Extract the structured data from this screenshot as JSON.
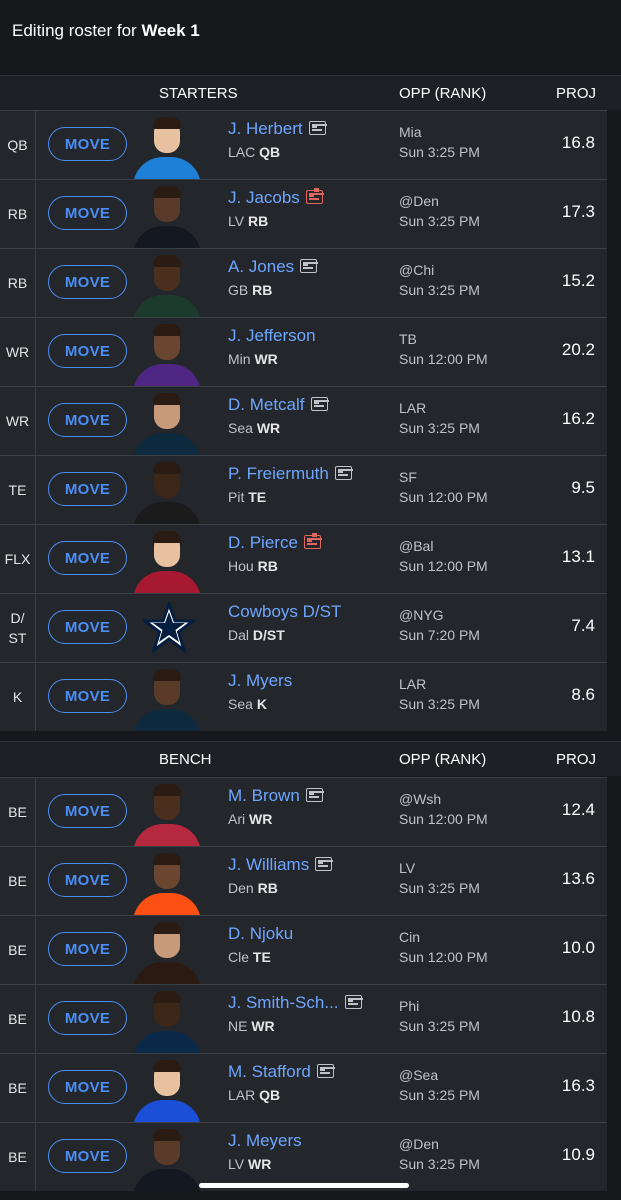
{
  "header": {
    "title_prefix": "Editing roster for",
    "title_week": "Week 1"
  },
  "columns": {
    "opp": "OPP (RANK)",
    "proj": "PROJ"
  },
  "move_label": "MOVE",
  "sections": {
    "starters": {
      "label": "STARTERS",
      "rows": [
        {
          "slot": "QB",
          "name": "J. Herbert",
          "team": "LAC",
          "pos": "QB",
          "news": "normal",
          "opp": "Mia",
          "game": "Sun 3:25 PM",
          "proj": "16.8"
        },
        {
          "slot": "RB",
          "name": "J. Jacobs",
          "team": "LV",
          "pos": "RB",
          "news": "alert",
          "opp": "@Den",
          "game": "Sun 3:25 PM",
          "proj": "17.3"
        },
        {
          "slot": "RB",
          "name": "A. Jones",
          "team": "GB",
          "pos": "RB",
          "news": "normal",
          "opp": "@Chi",
          "game": "Sun 3:25 PM",
          "proj": "15.2"
        },
        {
          "slot": "WR",
          "name": "J. Jefferson",
          "team": "Min",
          "pos": "WR",
          "news": "none",
          "opp": "TB",
          "game": "Sun 12:00 PM",
          "proj": "20.2"
        },
        {
          "slot": "WR",
          "name": "D. Metcalf",
          "team": "Sea",
          "pos": "WR",
          "news": "normal",
          "opp": "LAR",
          "game": "Sun 3:25 PM",
          "proj": "16.2"
        },
        {
          "slot": "TE",
          "name": "P. Freiermuth",
          "team": "Pit",
          "pos": "TE",
          "news": "normal",
          "opp": "SF",
          "game": "Sun 12:00 PM",
          "proj": "9.5"
        },
        {
          "slot": "FLX",
          "name": "D. Pierce",
          "team": "Hou",
          "pos": "RB",
          "news": "alert",
          "opp": "@Bal",
          "game": "Sun 12:00 PM",
          "proj": "13.1"
        },
        {
          "slot": "D/ ST",
          "name": "Cowboys D/ST",
          "team": "Dal",
          "pos": "D/ST",
          "news": "none",
          "opp": "@NYG",
          "game": "Sun 7:20 PM",
          "proj": "7.4"
        },
        {
          "slot": "K",
          "name": "J. Myers",
          "team": "Sea",
          "pos": "K",
          "news": "none",
          "opp": "LAR",
          "game": "Sun 3:25 PM",
          "proj": "8.6"
        }
      ]
    },
    "bench": {
      "label": "BENCH",
      "rows": [
        {
          "slot": "BE",
          "name": "M. Brown",
          "team": "Ari",
          "pos": "WR",
          "news": "normal",
          "opp": "@Wsh",
          "game": "Sun 12:00 PM",
          "proj": "12.4"
        },
        {
          "slot": "BE",
          "name": "J. Williams",
          "team": "Den",
          "pos": "RB",
          "news": "normal",
          "opp": "LV",
          "game": "Sun 3:25 PM",
          "proj": "13.6"
        },
        {
          "slot": "BE",
          "name": "D. Njoku",
          "team": "Cle",
          "pos": "TE",
          "news": "none",
          "opp": "Cin",
          "game": "Sun 12:00 PM",
          "proj": "10.0"
        },
        {
          "slot": "BE",
          "name": "J. Smith-Sch...",
          "team": "NE",
          "pos": "WR",
          "news": "normal",
          "opp": "Phi",
          "game": "Sun 3:25 PM",
          "proj": "10.8"
        },
        {
          "slot": "BE",
          "name": "M. Stafford",
          "team": "LAR",
          "pos": "QB",
          "news": "normal",
          "opp": "@Sea",
          "game": "Sun 3:25 PM",
          "proj": "16.3"
        },
        {
          "slot": "BE",
          "name": "J. Meyers",
          "team": "LV",
          "pos": "WR",
          "news": "none",
          "opp": "@Den",
          "game": "Sun 3:25 PM",
          "proj": "10.9"
        }
      ]
    }
  },
  "colors": {
    "background": "#16181c",
    "row": "#23262b",
    "accent": "#4b8ef5",
    "player_link": "#6ea6ff",
    "news_alert": "#e0665f"
  }
}
